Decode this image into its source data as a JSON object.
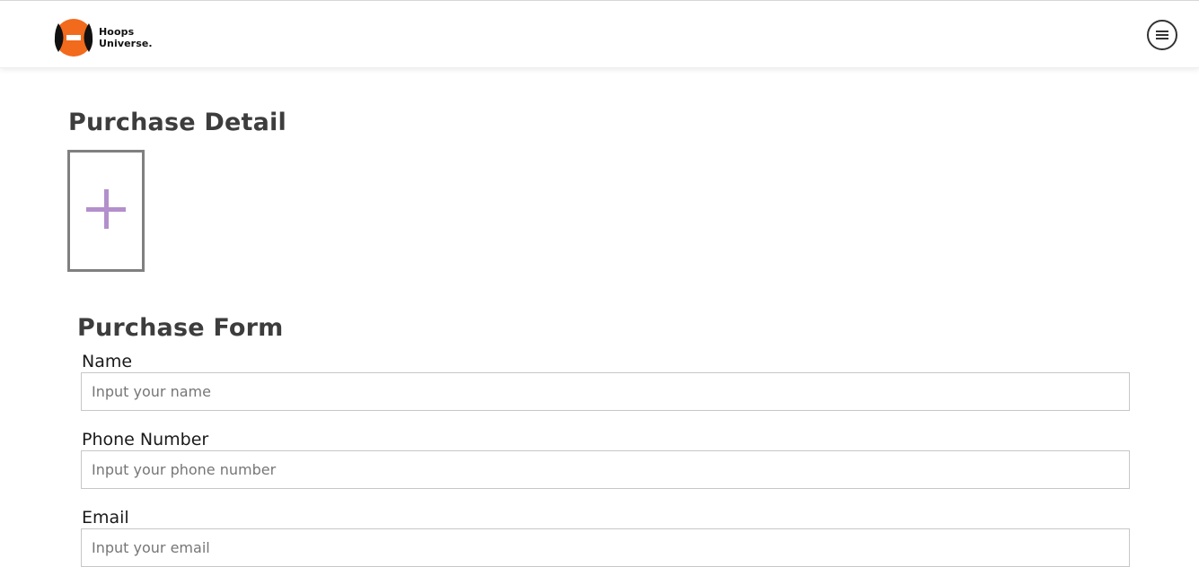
{
  "header": {
    "logo_line1": "Hoops",
    "logo_line2": "Universe.",
    "logo_colors": {
      "orange": "#f26a1b",
      "black": "#111111"
    },
    "menu_icon": "hamburger-menu-icon"
  },
  "detail": {
    "title": "Purchase Detail",
    "add_icon": "plus-icon",
    "plus_color": "#b38fcc"
  },
  "form": {
    "title": "Purchase Form",
    "fields": [
      {
        "label": "Name",
        "placeholder": "Input your name"
      },
      {
        "label": "Phone Number",
        "placeholder": "Input your phone number"
      },
      {
        "label": "Email",
        "placeholder": "Input your email"
      }
    ]
  }
}
